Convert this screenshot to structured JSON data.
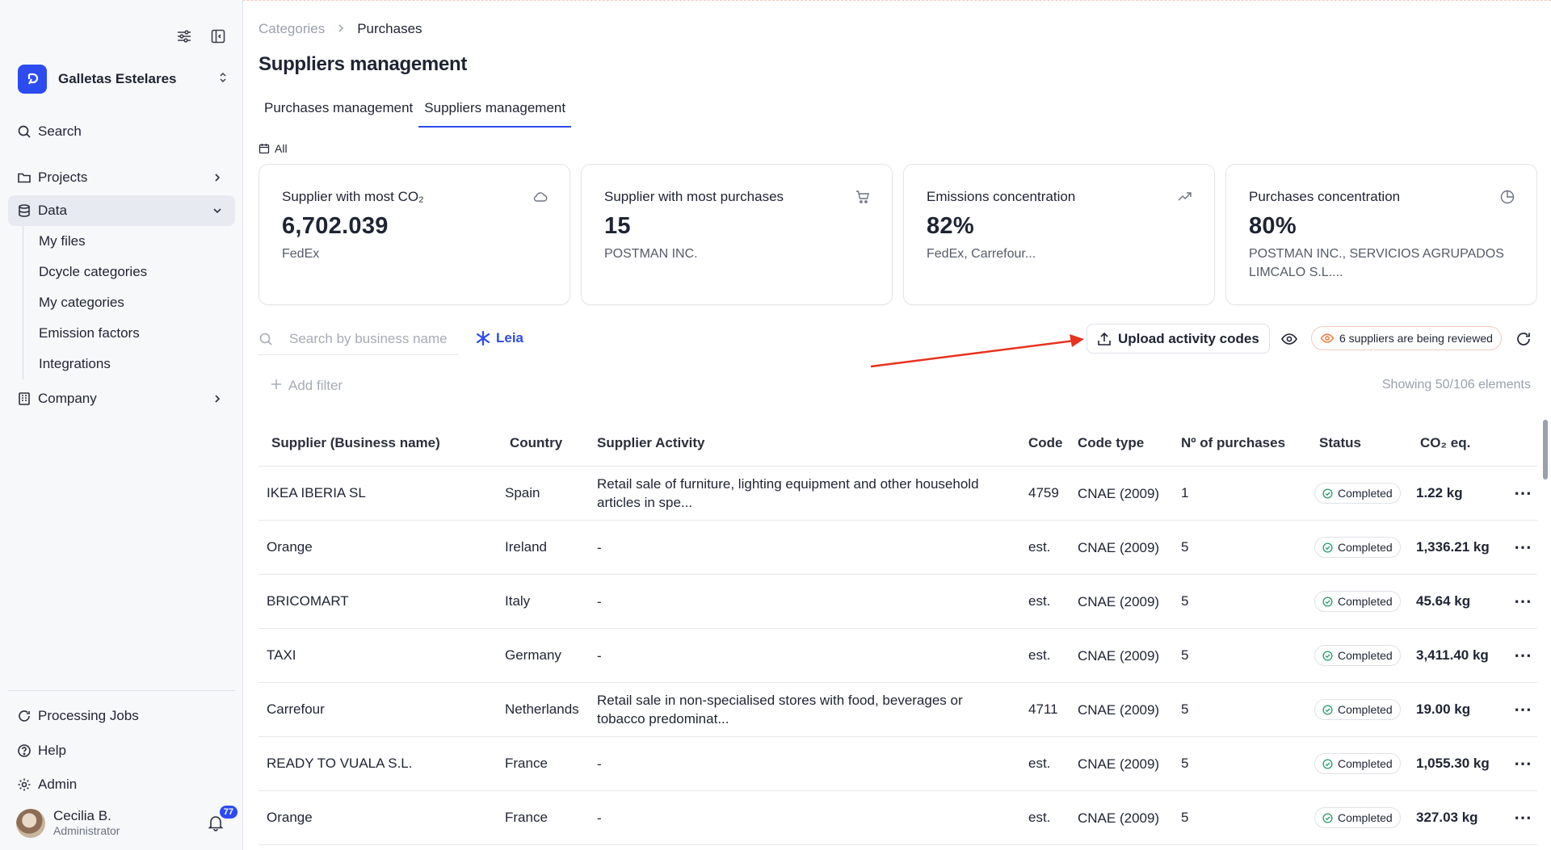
{
  "sidebar": {
    "org_name": "Galletas Estelares",
    "search_label": "Search",
    "projects_label": "Projects",
    "data_label": "Data",
    "data_items": [
      "My files",
      "Dcycle categories",
      "My categories",
      "Emission factors",
      "Integrations"
    ],
    "company_label": "Company",
    "processing_label": "Processing Jobs",
    "help_label": "Help",
    "admin_label": "Admin",
    "user_name": "Cecilia B.",
    "user_role": "Administrator",
    "notifications": "77"
  },
  "breadcrumb": {
    "parent": "Categories",
    "current": "Purchases"
  },
  "page_title": "Suppliers management",
  "tabs": [
    "Purchases management",
    "Suppliers management"
  ],
  "filter_period": "All",
  "cards": [
    {
      "title": "Supplier with most CO₂",
      "value": "6,702.039",
      "sub": "FedEx",
      "icon": "cloud-icon"
    },
    {
      "title": "Supplier with most purchases",
      "value": "15",
      "sub": "POSTMAN INC.",
      "icon": "cart-icon"
    },
    {
      "title": "Emissions concentration",
      "value": "82%",
      "sub": "FedEx, Carrefour...",
      "icon": "trend-up-icon"
    },
    {
      "title": "Purchases concentration",
      "value": "80%",
      "sub": "POSTMAN INC., SERVICIOS AGRUPADOS LIMCALO S.L....",
      "icon": "pie-chart-icon"
    }
  ],
  "toolbar": {
    "search_placeholder": "Search by business name",
    "leia_label": "Leia",
    "upload_label": "Upload activity codes",
    "review_label": "6 suppliers are being reviewed",
    "add_filter": "Add filter",
    "showing": "Showing 50/106 elements"
  },
  "colors": {
    "accent": "#2c4bf0",
    "arrow": "#e8321f",
    "review_icon": "#f07a3c",
    "status_icon": "#1f9d6b"
  },
  "table": {
    "headers": [
      "Supplier (Business name)",
      "Country",
      "Supplier Activity",
      "Code",
      "Code type",
      "Nº of purchases",
      "Status",
      "CO₂ eq."
    ],
    "rows": [
      {
        "name": "IKEA IBERIA SL",
        "country": "Spain",
        "activity": "Retail sale of furniture, lighting equipment and other household articles in spe...",
        "code": "4759",
        "code_type": "CNAE (2009)",
        "purchases": "1",
        "status": "Completed",
        "co2": "1.22 kg"
      },
      {
        "name": "Orange",
        "country": "Ireland",
        "activity": "-",
        "code": "est.",
        "code_type": "CNAE (2009)",
        "purchases": "5",
        "status": "Completed",
        "co2": "1,336.21 kg"
      },
      {
        "name": "BRICOMART",
        "country": "Italy",
        "activity": "-",
        "code": "est.",
        "code_type": "CNAE (2009)",
        "purchases": "5",
        "status": "Completed",
        "co2": "45.64 kg"
      },
      {
        "name": "TAXI",
        "country": "Germany",
        "activity": "-",
        "code": "est.",
        "code_type": "CNAE (2009)",
        "purchases": "5",
        "status": "Completed",
        "co2": "3,411.40 kg"
      },
      {
        "name": "Carrefour",
        "country": "Netherlands",
        "activity": "Retail sale in non-specialised stores with food, beverages or tobacco predominat...",
        "code": "4711",
        "code_type": "CNAE (2009)",
        "purchases": "5",
        "status": "Completed",
        "co2": "19.00 kg"
      },
      {
        "name": "READY TO VUALA S.L.",
        "country": "France",
        "activity": "-",
        "code": "est.",
        "code_type": "CNAE (2009)",
        "purchases": "5",
        "status": "Completed",
        "co2": "1,055.30 kg"
      },
      {
        "name": "Orange",
        "country": "France",
        "activity": "-",
        "code": "est.",
        "code_type": "CNAE (2009)",
        "purchases": "5",
        "status": "Completed",
        "co2": "327.03 kg"
      }
    ]
  }
}
